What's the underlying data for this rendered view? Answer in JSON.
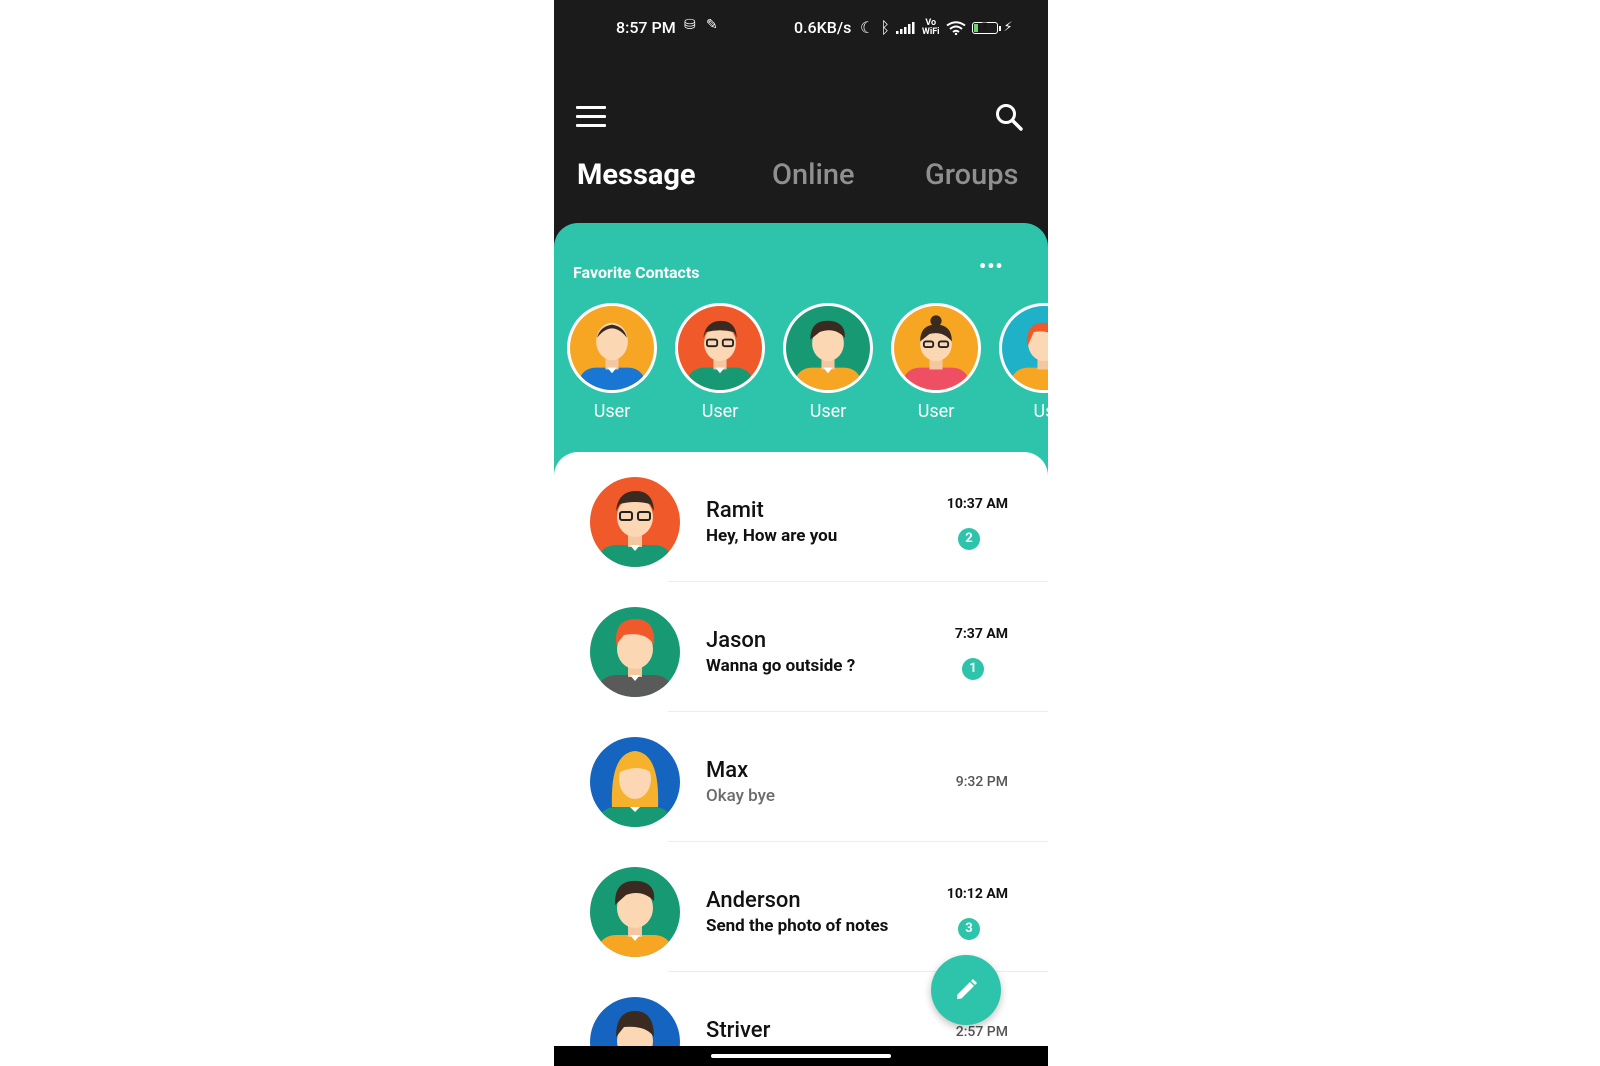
{
  "status_bar": {
    "time": "8:57 PM",
    "speed": "0.6KB/s",
    "vowifi_top": "Vo",
    "vowifi_bottom": "WiFi",
    "battery_level": "7"
  },
  "app_bar": {
    "menu_icon": "hamburger-menu-icon",
    "search_icon": "search-icon"
  },
  "tabs": [
    {
      "label": "Message",
      "active": true
    },
    {
      "label": "Online",
      "active": false
    },
    {
      "label": "Groups",
      "active": false
    }
  ],
  "favorites": {
    "title": "Favorite Contacts",
    "more_label": "•••",
    "contacts": [
      {
        "name": "User",
        "bg": "#f6a623"
      },
      {
        "name": "User",
        "bg": "#f0592a"
      },
      {
        "name": "User",
        "bg": "#179a73"
      },
      {
        "name": "User",
        "bg": "#f6a623"
      },
      {
        "name": "Us",
        "bg": "#1fb1c7"
      }
    ]
  },
  "chats": [
    {
      "name": "Ramit",
      "message": "Hey, How are you",
      "time": "10:37 AM",
      "unread": "2",
      "bg": "#f0592a"
    },
    {
      "name": "Jason",
      "message": "Wanna go outside ?",
      "time": "7:37 AM",
      "unread": "1",
      "bg": "#179a73"
    },
    {
      "name": "Max",
      "message": "Okay bye",
      "time": "9:32 PM",
      "unread": "",
      "bg": "#1565c0"
    },
    {
      "name": "Anderson",
      "message": "Send the photo of notes",
      "time": "10:12 AM",
      "unread": "3",
      "bg": "#179a73"
    },
    {
      "name": "Striver",
      "message": "",
      "time": "2:57 PM",
      "unread": "",
      "bg": "#1565c0"
    }
  ],
  "fab": {
    "icon": "pencil-icon"
  },
  "colors": {
    "accent": "#2ec4ab",
    "dark": "#1b1b1b"
  }
}
